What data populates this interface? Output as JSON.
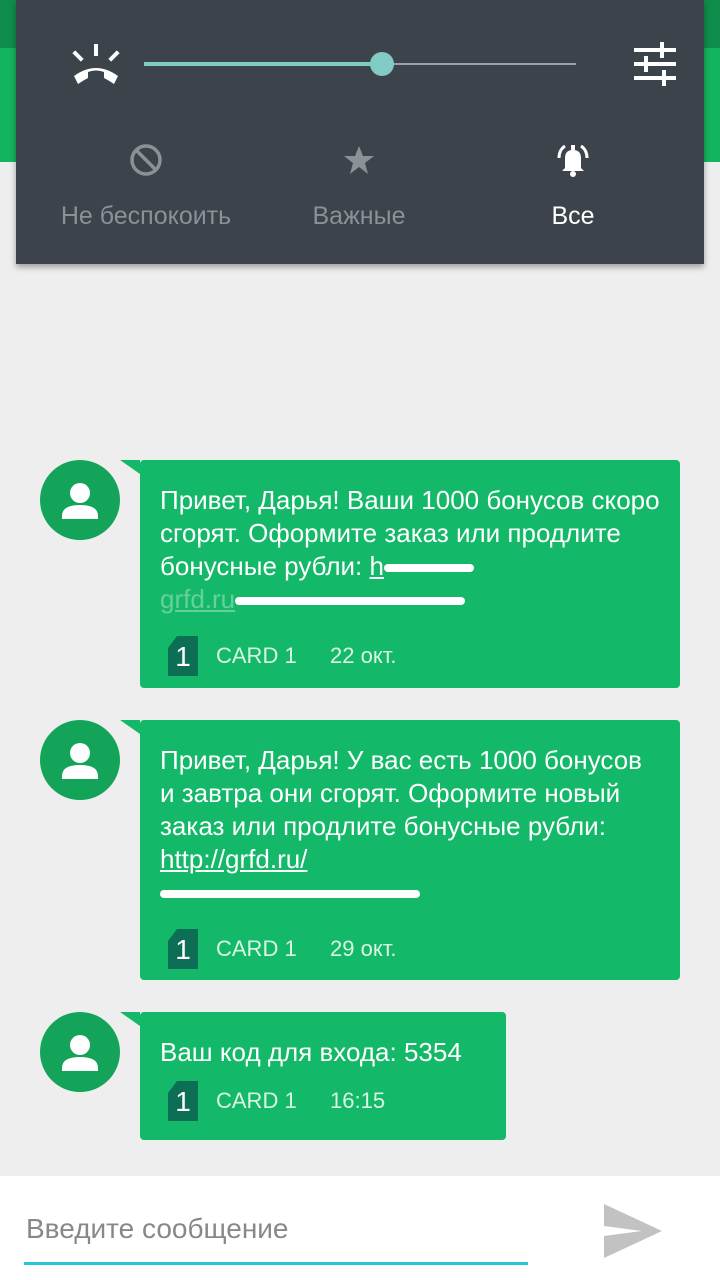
{
  "volume": {
    "level": 0.55
  },
  "modes": [
    {
      "label": "Не беспокоить",
      "icon": "block-icon",
      "active": false
    },
    {
      "label": "Важные",
      "icon": "star-icon",
      "active": false
    },
    {
      "label": "Все",
      "icon": "bell-ring-icon",
      "active": true
    }
  ],
  "messages": [
    {
      "text": "Привет, Дарья! Ваши 1000 бонусов скоро сгорят. Оформите заказ или продлите бонусные рубли: ",
      "link_fragment_1": "h",
      "link_fragment_2": "grfd.ru",
      "sim": "1",
      "card": "CARD 1",
      "time": "22 окт."
    },
    {
      "text": "Привет, Дарья! У вас есть 1000 бонусов и завтра они сгорят. Оформите новый заказ или продлите бонусные рубли: ",
      "link_fragment_1": "http://grfd.ru/",
      "sim": "1",
      "card": "CARD 1",
      "time": "29 окт."
    },
    {
      "text": "Ваш код для входа: 5354",
      "sim": "1",
      "card": "CARD 1",
      "time": "16:15"
    }
  ],
  "composer": {
    "placeholder": "Введите сообщение"
  },
  "colors": {
    "accent": "#13b45f",
    "bubble": "#13b868",
    "panel": "#3c434b",
    "slider": "#80cbc4",
    "input_line": "#26c6da"
  }
}
